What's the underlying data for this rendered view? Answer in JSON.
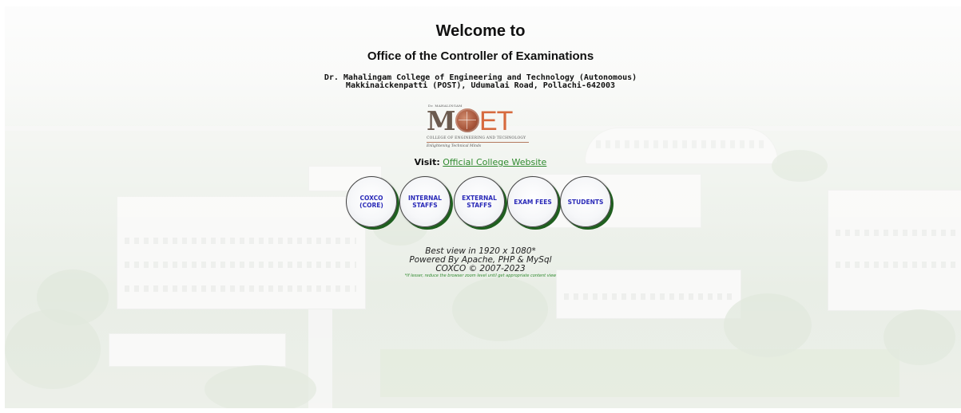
{
  "header": {
    "welcome": "Welcome to",
    "office": "Office of the Controller of Examinations",
    "address_line1": "Dr. Mahalingam College of Engineering and Technology (Autonomous)",
    "address_line2": "Makkinaickenpatti (POST), Udumalai Road, Pollachi-642003"
  },
  "logo": {
    "top_text": "Dr. MAHALINGAM",
    "mark_m": "M",
    "mark_et": "ET",
    "subtitle": "COLLEGE OF ENGINEERING AND TECHNOLOGY",
    "tagline": "Enlightening Technical Minds"
  },
  "visit": {
    "label": "Visit:",
    "link_text": "Official College Website"
  },
  "buttons": [
    {
      "label": "COXCO\n(CORE)"
    },
    {
      "label": "INTERNAL\nSTAFFS"
    },
    {
      "label": "EXTERNAL\nSTAFFS"
    },
    {
      "label": "EXAM FEES"
    },
    {
      "label": "STUDENTS"
    }
  ],
  "footer": {
    "best_view": "Best view in 1920 x 1080*",
    "powered": "Powered By Apache, PHP & MySql",
    "copyright": "COXCO © 2007-2023",
    "note": "*If lesser, reduce the browser zoom level until get appropriate content view"
  },
  "colors": {
    "link": "#2f8a2f",
    "button_text": "#2a2ab8",
    "button_shadow": "#1f5f1f",
    "logo_mark": "#6b5a4e",
    "logo_accent": "#d76a3e"
  }
}
